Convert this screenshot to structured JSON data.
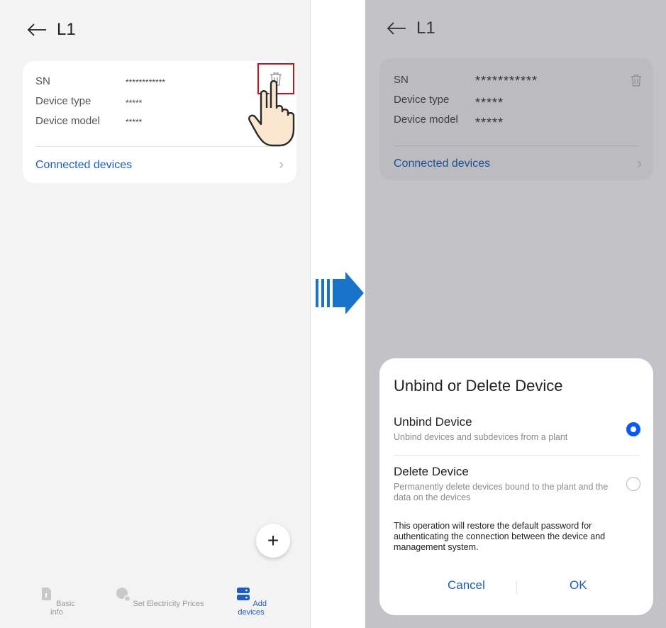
{
  "left": {
    "title": "L1",
    "card": {
      "sn_label": "SN",
      "sn_value": "************",
      "type_label": "Device type",
      "type_value": "*****",
      "model_label": "Device model",
      "model_value": "*****",
      "link": "Connected devices",
      "chevron": "›"
    },
    "fab": "+",
    "tabs": [
      {
        "label": "Basic info",
        "icon": "document-icon"
      },
      {
        "label": "Set Electricity Prices",
        "icon": "price-icon"
      },
      {
        "label": "Add devices",
        "icon": "devices-icon"
      }
    ],
    "highlight_color": "#c4141c"
  },
  "right": {
    "title": "L1",
    "card": {
      "sn_label": "SN",
      "sn_value": "***********",
      "type_label": "Device type",
      "type_value": "*****",
      "model_label": "Device model",
      "model_value": "*****",
      "link": "Connected devices",
      "chevron": "›"
    },
    "dialog": {
      "title": "Unbind or Delete Device",
      "options": [
        {
          "name": "Unbind Device",
          "desc": "Unbind devices and subdevices from a plant",
          "selected": true
        },
        {
          "name": "Delete Device",
          "desc": "Permanently delete devices bound to the plant and the data on the devices",
          "selected": false
        }
      ],
      "note": "This operation will restore the default password for authenticating the connection between the device and management system.",
      "cancel": "Cancel",
      "ok": "OK"
    }
  },
  "colors": {
    "accent": "#1e5dba",
    "radio_on": "#0a59f7",
    "flow_arrow": "#1a73c8"
  }
}
